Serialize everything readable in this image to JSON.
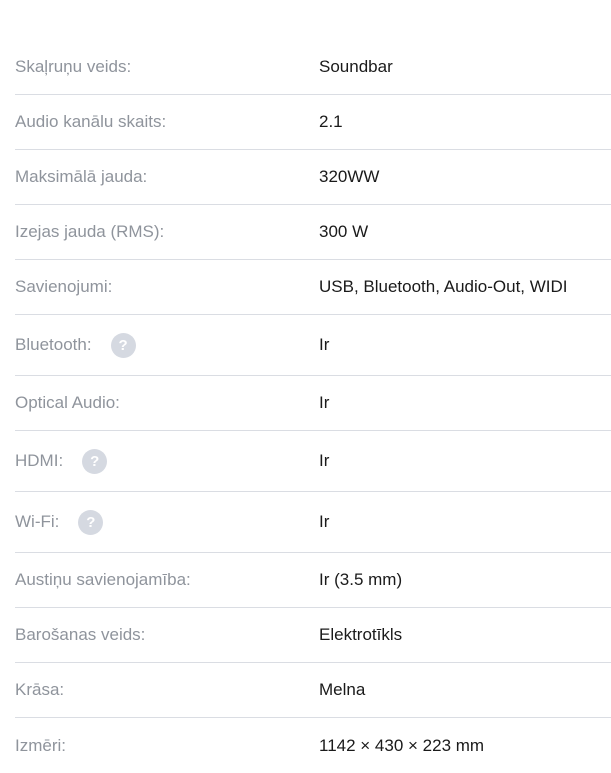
{
  "specs": [
    {
      "label": "Skaļruņu veids:",
      "value": "Soundbar",
      "help": false
    },
    {
      "label": "Audio kanālu skaits:",
      "value": "2.1",
      "help": false
    },
    {
      "label": "Maksimālā jauda:",
      "value": "320WW",
      "help": false
    },
    {
      "label": "Izejas jauda (RMS):",
      "value": "300 W",
      "help": false
    },
    {
      "label": "Savienojumi:",
      "value": "USB, Bluetooth, Audio-Out, WIDI",
      "help": false
    },
    {
      "label": "Bluetooth:",
      "value": "Ir",
      "help": true
    },
    {
      "label": "Optical Audio:",
      "value": "Ir",
      "help": false
    },
    {
      "label": "HDMI:",
      "value": "Ir",
      "help": true
    },
    {
      "label": "Wi-Fi:",
      "value": "Ir",
      "help": true
    },
    {
      "label": "Austiņu savienojamība:",
      "value": "Ir (3.5 mm)",
      "help": false
    },
    {
      "label": "Barošanas veids:",
      "value": "Elektrotīkls",
      "help": false
    },
    {
      "label": "Krāsa:",
      "value": "Melna",
      "help": false
    },
    {
      "label": "Izmēri:",
      "value": "1142 × 430 × 223 mm",
      "help": false
    }
  ],
  "help_icon_glyph": "?",
  "colors": {
    "label": "#8f949c",
    "value": "#1a1a1a",
    "divider": "#dadde3",
    "help_icon_bg": "#d5d9e1"
  }
}
